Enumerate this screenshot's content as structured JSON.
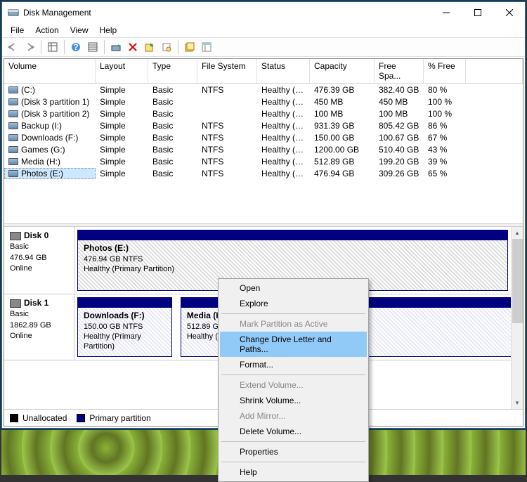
{
  "window": {
    "title": "Disk Management"
  },
  "menu": {
    "file": "File",
    "action": "Action",
    "view": "View",
    "help": "Help"
  },
  "columns": {
    "volume": "Volume",
    "layout": "Layout",
    "type": "Type",
    "fs": "File System",
    "status": "Status",
    "capacity": "Capacity",
    "free": "Free Spa...",
    "pct": "% Free"
  },
  "volumes": [
    {
      "name": "(C:)",
      "layout": "Simple",
      "type": "Basic",
      "fs": "NTFS",
      "status": "Healthy (B...",
      "capacity": "476.39 GB",
      "free": "382.40 GB",
      "pct": "80 %"
    },
    {
      "name": "(Disk 3 partition 1)",
      "layout": "Simple",
      "type": "Basic",
      "fs": "",
      "status": "Healthy (E...",
      "capacity": "450 MB",
      "free": "450 MB",
      "pct": "100 %"
    },
    {
      "name": "(Disk 3 partition 2)",
      "layout": "Simple",
      "type": "Basic",
      "fs": "",
      "status": "Healthy (E...",
      "capacity": "100 MB",
      "free": "100 MB",
      "pct": "100 %"
    },
    {
      "name": "Backup (I:)",
      "layout": "Simple",
      "type": "Basic",
      "fs": "NTFS",
      "status": "Healthy (P...",
      "capacity": "931.39 GB",
      "free": "805.42 GB",
      "pct": "86 %"
    },
    {
      "name": "Downloads (F:)",
      "layout": "Simple",
      "type": "Basic",
      "fs": "NTFS",
      "status": "Healthy (P...",
      "capacity": "150.00 GB",
      "free": "100.67 GB",
      "pct": "67 %"
    },
    {
      "name": "Games (G:)",
      "layout": "Simple",
      "type": "Basic",
      "fs": "NTFS",
      "status": "Healthy (P...",
      "capacity": "1200.00 GB",
      "free": "510.40 GB",
      "pct": "43 %"
    },
    {
      "name": "Media (H:)",
      "layout": "Simple",
      "type": "Basic",
      "fs": "NTFS",
      "status": "Healthy (P...",
      "capacity": "512.89 GB",
      "free": "199.20 GB",
      "pct": "39 %"
    },
    {
      "name": "Photos (E:)",
      "layout": "Simple",
      "type": "Basic",
      "fs": "NTFS",
      "status": "Healthy (P...",
      "capacity": "476.94 GB",
      "free": "309.26 GB",
      "pct": "65 %"
    }
  ],
  "disks": [
    {
      "label": "Disk 0",
      "type": "Basic",
      "size": "476.94 GB",
      "state": "Online",
      "parts": [
        {
          "name": "Photos  (E:)",
          "info": "476.94 GB NTFS",
          "health": "Healthy (Primary Partition)",
          "sel": true
        }
      ]
    },
    {
      "label": "Disk 1",
      "type": "Basic",
      "size": "1862.89 GB",
      "state": "Online",
      "parts": [
        {
          "name": "Downloads  (F:)",
          "info": "150.00 GB NTFS",
          "health": "Healthy (Primary Partition)"
        },
        {
          "name": "Media  (H:)",
          "info": "512.89 GB NTFS",
          "health": "Healthy (Primary Partition)"
        }
      ]
    }
  ],
  "legend": {
    "unalloc": "Unallocated",
    "primary": "Primary partition"
  },
  "ctx": {
    "open": "Open",
    "explore": "Explore",
    "mark": "Mark Partition as Active",
    "change": "Change Drive Letter and Paths...",
    "format": "Format...",
    "extend": "Extend Volume...",
    "shrink": "Shrink Volume...",
    "mirror": "Add Mirror...",
    "delete": "Delete Volume...",
    "props": "Properties",
    "help": "Help"
  }
}
